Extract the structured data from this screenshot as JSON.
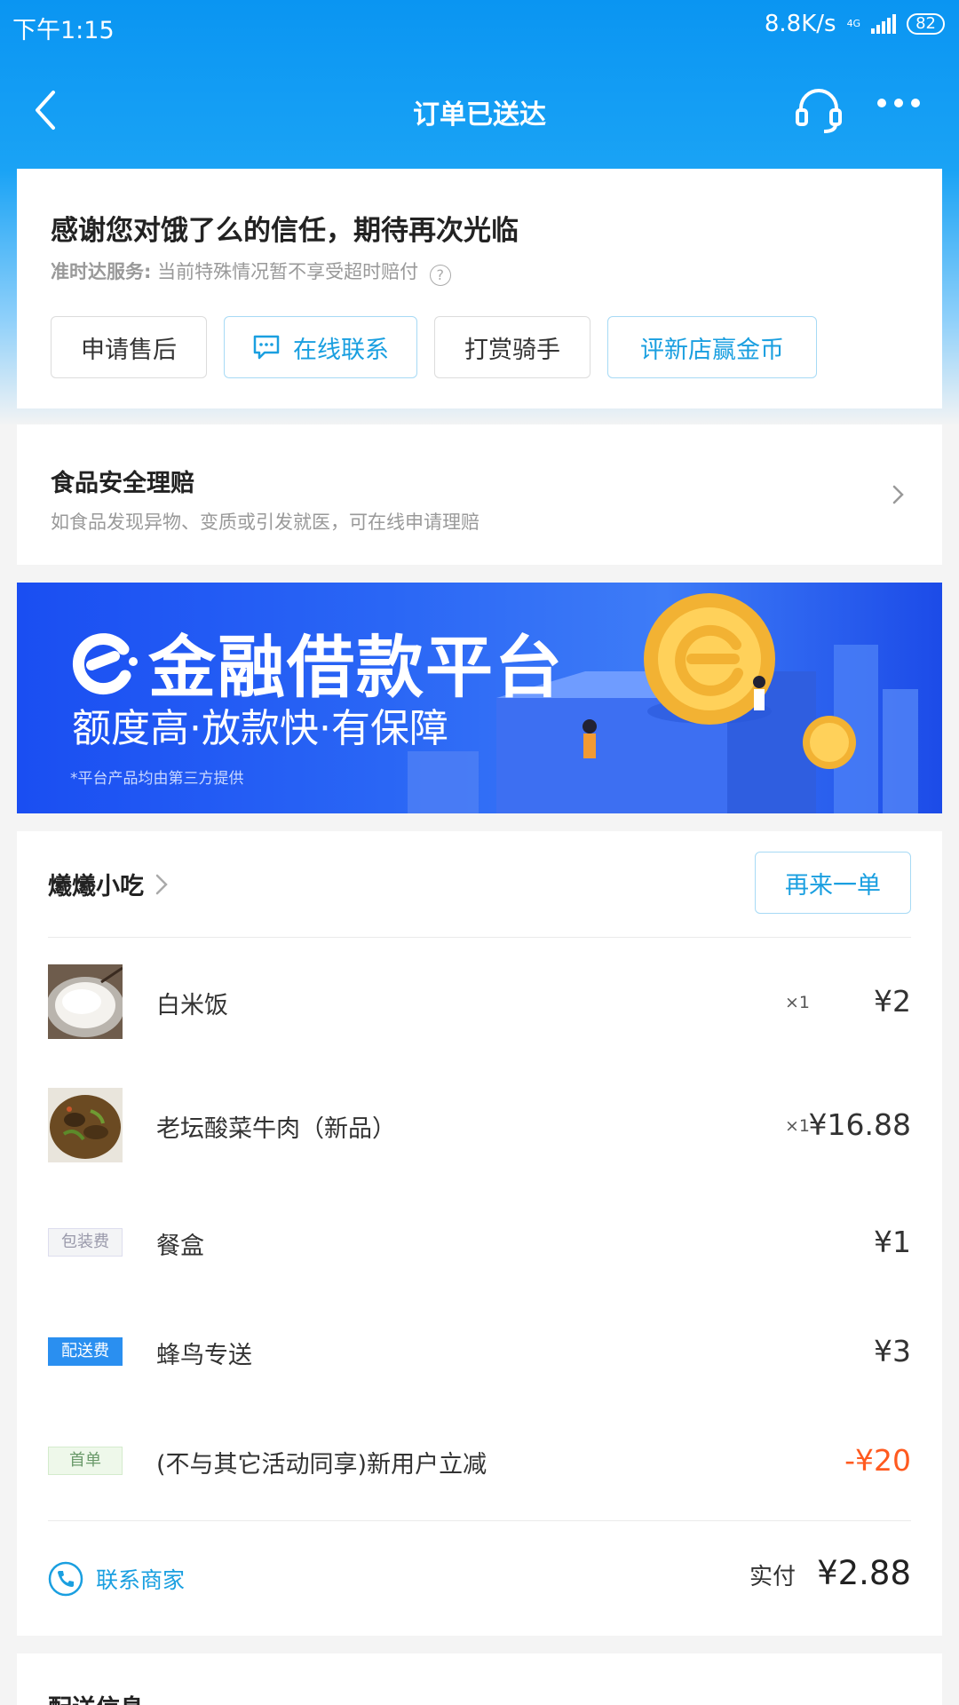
{
  "statusbar": {
    "time": "下午1:15",
    "speed": "8.8K/s",
    "network": "4G",
    "battery": "82"
  },
  "nav": {
    "title": "订单已送达"
  },
  "status": {
    "title": "感谢您对饿了么的信任，期待再次光临",
    "service_label": "准时达服务:",
    "service_text": "当前特殊情况暂不享受超时赔付",
    "buttons": [
      "申请售后",
      "在线联系",
      "打赏骑手",
      "评新店赢金币"
    ]
  },
  "food_safety": {
    "title": "食品安全理赔",
    "desc": "如食品发现异物、变质或引发就医，可在线申请理赔"
  },
  "banner": {
    "title": "金融借款平台",
    "subtitle": "额度高·放款快·有保障",
    "note": "*平台产品均由第三方提供"
  },
  "order": {
    "shop": "爔爔小吃",
    "reorder": "再来一单",
    "items": [
      {
        "name": "白米饭",
        "qty": "×1",
        "price": "¥2"
      },
      {
        "name": "老坛酸菜牛肉（新品）",
        "qty": "×1",
        "price": "¥16.88"
      }
    ],
    "fees": [
      {
        "tag": "包装费",
        "name": "餐盒",
        "price": "¥1"
      },
      {
        "tag": "配送费",
        "name": "蜂鸟专送",
        "price": "¥3"
      },
      {
        "tag": "首单",
        "name": "(不与其它活动同享)新用户立减",
        "price": "-¥20"
      }
    ],
    "contact": "联系商家",
    "paid_label": "实付",
    "paid_amount": "¥2.88"
  },
  "delivery": {
    "title": "配送信息"
  },
  "colors": {
    "primary": "#1a9fe0",
    "header": "#0a95f2",
    "discount": "#ff5a1f",
    "banner": "#2a66f5"
  }
}
